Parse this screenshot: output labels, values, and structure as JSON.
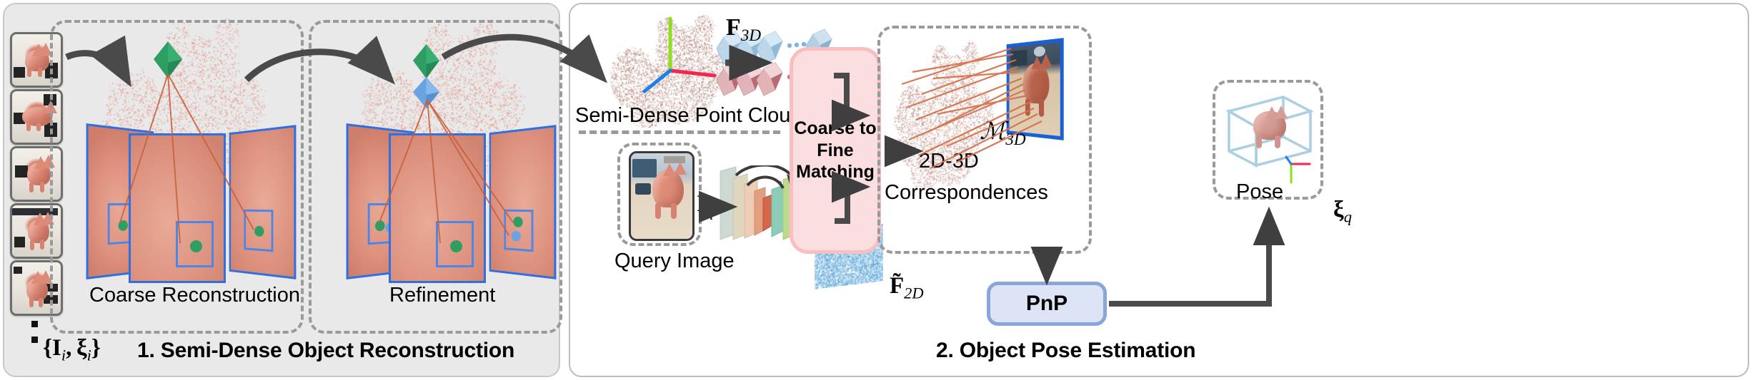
{
  "figure": {
    "caption_parts": [
      "1. Semi-Dense Object Reconstruction",
      "2. Object Pose Estimation"
    ]
  },
  "stage1": {
    "title": "1. Semi-Dense Object Reconstruction",
    "input_notation": "{Iᵢ, ξᵢ}",
    "input_strip_name": "reference-image-sequence",
    "thumbnail_count": 5,
    "sub_panels": [
      {
        "id": "coarse",
        "label": "Coarse Reconstruction",
        "marker": "green-diamond"
      },
      {
        "id": "refinement",
        "label": "Refinement",
        "marker": "blue-diamond"
      }
    ],
    "keypoint_colors": {
      "coarse": "#2f9e63",
      "refined": "#6aa3e2"
    },
    "camera_frame_color": "#2f6fe0",
    "point_cloud_color": "#e09a8d"
  },
  "stage2": {
    "title": "2. Object Pose Estimation",
    "point_cloud": {
      "label": "Semi-Dense Point Cloud",
      "axes": [
        {
          "name": "y-axis",
          "color": "#8ede1f"
        },
        {
          "name": "x-axis",
          "color": "#f4264e"
        },
        {
          "name": "z-axis",
          "color": "#1f7fe8"
        }
      ]
    },
    "features_3d": {
      "label": "F",
      "sub": "3D",
      "full": "F₃ₔ"
    },
    "query": {
      "panel_label": "Query Image",
      "symbol": "I",
      "symbol_sub": "q"
    },
    "features_2d": {
      "label": "F̃",
      "sub": "2D",
      "full": "F̃₂ₔ"
    },
    "matching_box": {
      "label": "Coarse to\nFine\nMatching",
      "lines": [
        "Coarse to",
        "Fine",
        "Matching"
      ],
      "fill": "#fbdfe0",
      "border": "#f9bec0"
    },
    "correspondences": {
      "label_line1": "2D-3D",
      "label_line2": "Correspondences",
      "match_symbol": "M",
      "match_symbol_sub": "3D",
      "match_line_color": "#d4734e"
    },
    "pnp": {
      "label": "PnP",
      "fill": "#dde4f5",
      "border": "#8aa6d8"
    },
    "pose": {
      "label": "Pose",
      "symbol": "ξ",
      "symbol_sub": "q",
      "bbox_color": "#a9cfe0"
    }
  },
  "palette": {
    "panel_left_bg": "#e9e9e9",
    "panel_right_bg": "#ffffff",
    "dashed_border": "#9a9a9a",
    "arrow": "#4a4a4a"
  }
}
